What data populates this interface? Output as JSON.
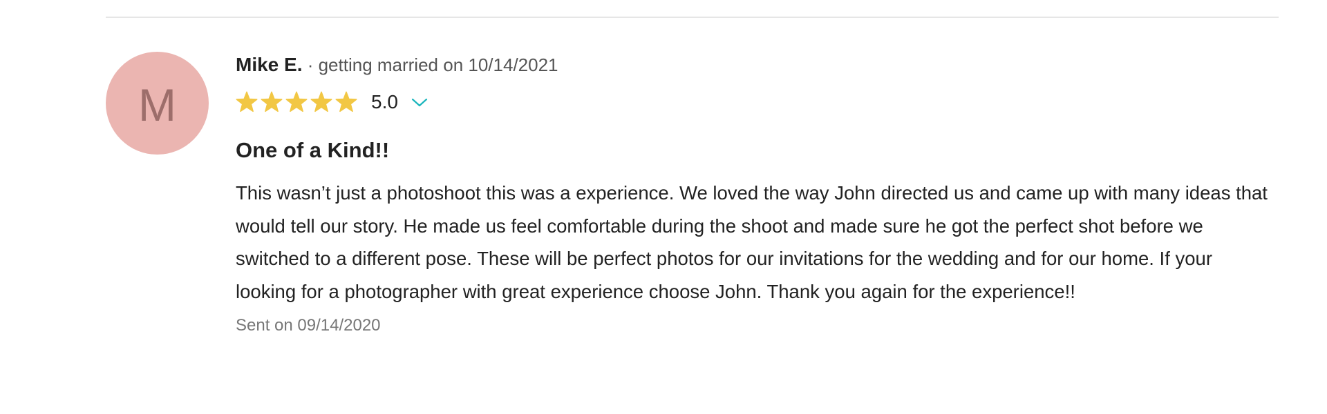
{
  "review": {
    "avatar_letter": "M",
    "author_name": "Mike E.",
    "author_meta": " · getting married on 10/14/2021",
    "rating": {
      "stars": 5,
      "max_stars": 5,
      "value_label": "5.0",
      "star_color": "#f2c744"
    },
    "title": "One of a Kind!!",
    "body": "This wasn’t just a photoshoot this was a experience. We loved the way John directed us and came up with many ideas that would tell our story. He made us feel comfortable during the shoot and made sure he got the perfect shot before we switched to a different pose. These will be perfect photos for our invitations for the wedding and for our home. If your looking for a photographer with great experience choose John. Thank you again for the experience!!",
    "sent_date": "Sent on 09/14/2020"
  },
  "colors": {
    "avatar_bg": "#ebb5b1",
    "avatar_letter": "#9d6e6b",
    "chevron": "#19b5bc",
    "divider": "#e6e6e6"
  },
  "icons": {
    "star": "star-icon",
    "expand": "chevron-down-icon"
  }
}
